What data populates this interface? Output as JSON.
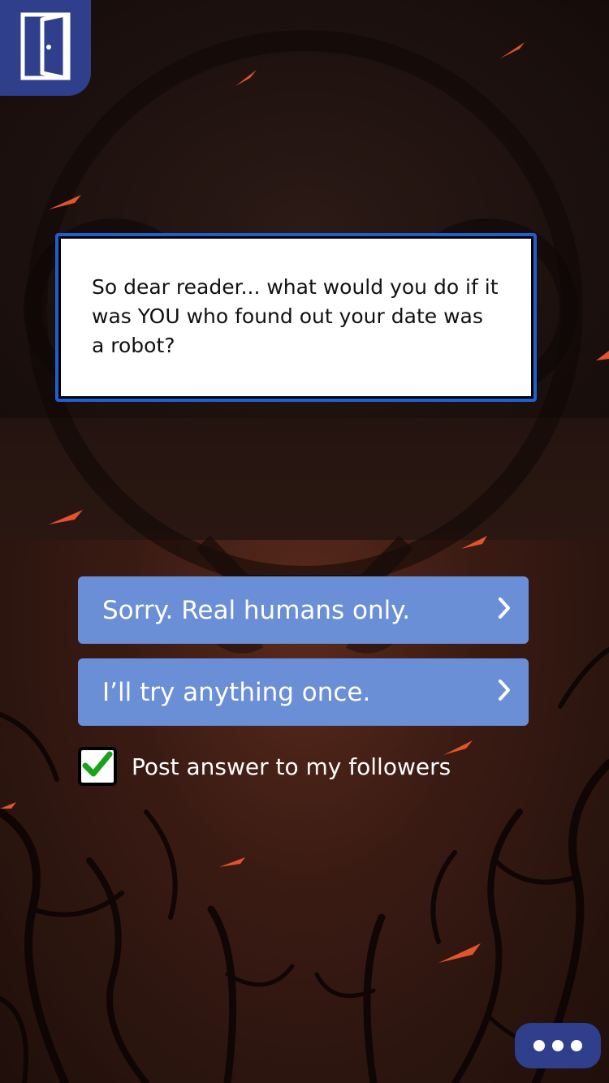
{
  "story": {
    "text": "So dear reader... what would you do if it was YOU who found out your date was a robot?"
  },
  "choices": [
    {
      "label": "Sorry.  Real humans only."
    },
    {
      "label": "I’ll try anything once."
    }
  ],
  "post_option": {
    "label": "Post answer to my followers",
    "checked": true
  },
  "icons": {
    "exit": "door-exit-icon",
    "chevron": "chevron-right-icon",
    "more": "more-dots-icon"
  },
  "colors": {
    "accent": "#2f3f8c",
    "choice": "#6b8fd6",
    "box_border": "#1f5fd0",
    "check": "#1aa31a"
  }
}
